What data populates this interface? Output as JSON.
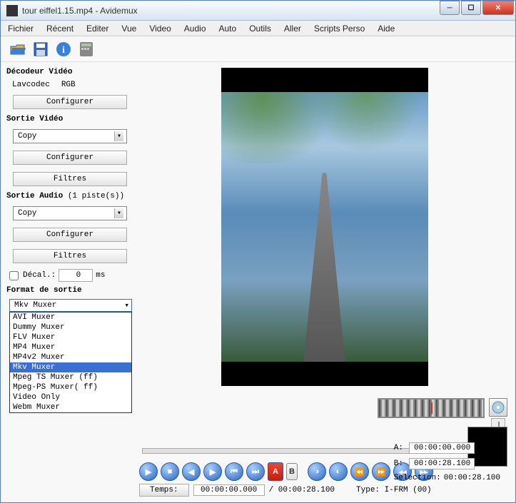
{
  "titlebar": {
    "title": "tour eiffel1.15.mp4 - Avidemux"
  },
  "menu": [
    "Fichier",
    "Récent",
    "Editer",
    "Vue",
    "Video",
    "Audio",
    "Auto",
    "Outils",
    "Aller",
    "Scripts Perso",
    "Aide"
  ],
  "toolbar_icons": [
    "open-icon",
    "save-icon",
    "info-icon",
    "calc-icon"
  ],
  "decoder": {
    "title": "Décodeur Vidéo",
    "codec": "Lavcodec",
    "mode": "RGB",
    "configure": "Configurer"
  },
  "video_out": {
    "title": "Sortie Vidéo",
    "selected": "Copy",
    "configure": "Configurer",
    "filters": "Filtres"
  },
  "audio_out": {
    "title": "Sortie Audio",
    "tracks_suffix": "(1 piste(s))",
    "selected": "Copy",
    "configure": "Configurer",
    "filters": "Filtres",
    "decal_label": "Décal.:",
    "decal_value": "0",
    "decal_unit": "ms"
  },
  "format": {
    "title": "Format de sortie",
    "selected": "Mkv Muxer",
    "options": [
      "AVI Muxer",
      "Dummy Muxer",
      "FLV Muxer",
      "MP4 Muxer",
      "MP4v2 Muxer",
      "Mkv Muxer",
      "Mpeg TS Muxer (ff)",
      "Mpeg-PS Muxer( ff)",
      "Video Only",
      "Webm Muxer"
    ]
  },
  "marks": {
    "a_label": "A:",
    "a_time": "00:00:00.000",
    "b_label": "B:",
    "b_time": "00:00:28.100",
    "sel_label": "Selection:",
    "sel_time": "00:00:28.100"
  },
  "time": {
    "btn": "Temps:",
    "current": "00:00:00.000",
    "total": "/ 00:00:28.100",
    "type": "Type: I-FRM (00)"
  }
}
